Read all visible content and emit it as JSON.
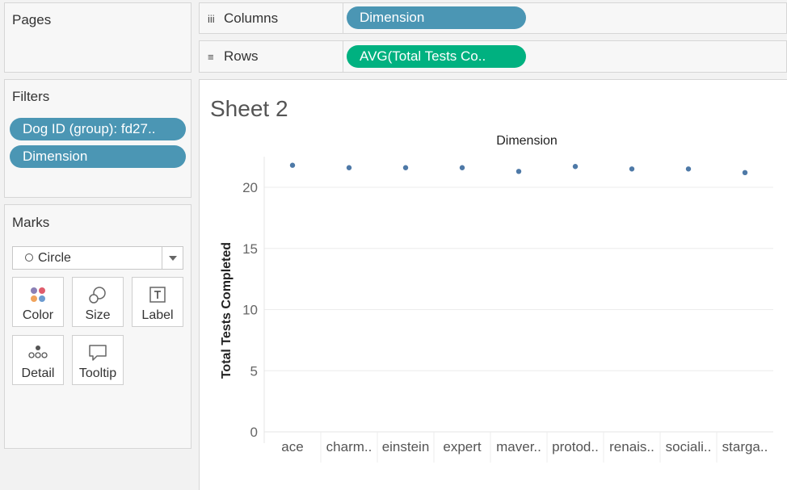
{
  "pages": {
    "title": "Pages"
  },
  "filters": {
    "title": "Filters",
    "pills": [
      "Dog ID (group): fd27..",
      "Dimension"
    ]
  },
  "marks": {
    "title": "Marks",
    "mark_type": "Circle",
    "buttons": {
      "color": "Color",
      "size": "Size",
      "label": "Label",
      "detail": "Detail",
      "tooltip": "Tooltip"
    }
  },
  "shelves": {
    "columns": {
      "label": "Columns",
      "pill": "Dimension"
    },
    "rows": {
      "label": "Rows",
      "pill": "AVG(Total Tests Co.."
    }
  },
  "sheet": {
    "title": "Sheet 2"
  },
  "colors": {
    "dimension_pill": "#4b96b4",
    "measure_pill": "#00b180",
    "mark": "#4e79a7"
  },
  "chart_data": {
    "type": "scatter",
    "title": "Dimension",
    "ylabel": "Total Tests Completed",
    "xlabel": "",
    "categories": [
      "ace",
      "charm..",
      "einstein",
      "expert",
      "maver..",
      "protod..",
      "renais..",
      "sociali..",
      "starga.."
    ],
    "values": [
      21.8,
      21.6,
      21.6,
      21.6,
      21.3,
      21.7,
      21.5,
      21.5,
      21.2
    ],
    "ylim": [
      0,
      22.5
    ],
    "yticks": [
      0,
      5,
      10,
      15,
      20
    ],
    "grid": true
  }
}
